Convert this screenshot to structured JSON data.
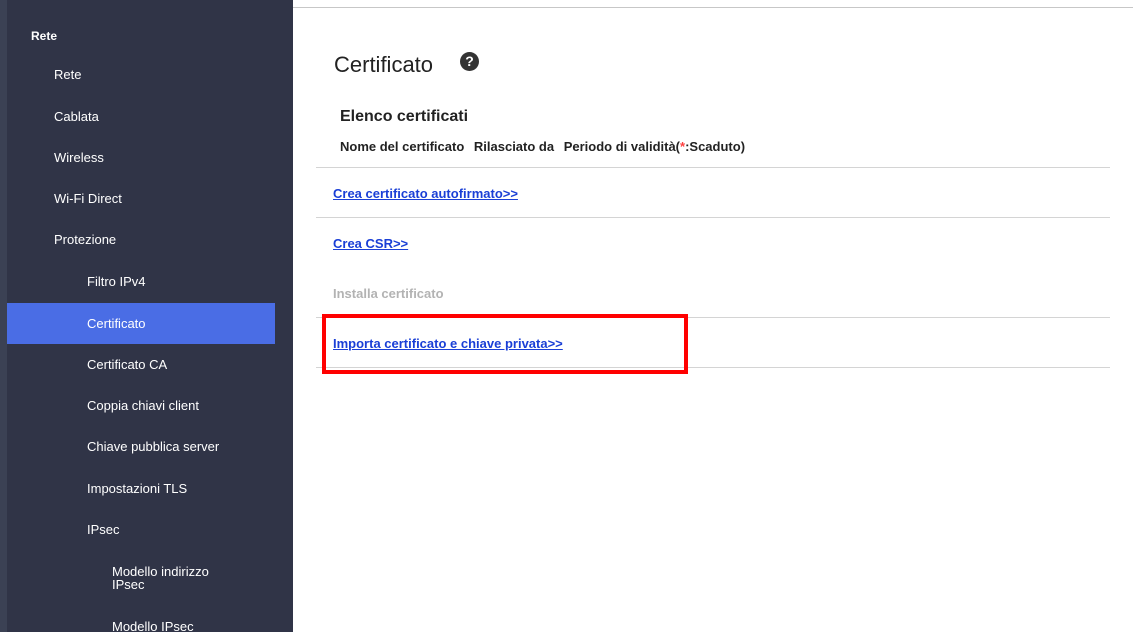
{
  "sidebar": {
    "items": [
      {
        "label": "Rete"
      },
      {
        "label": "Rete"
      },
      {
        "label": "Cablata"
      },
      {
        "label": "Wireless"
      },
      {
        "label": "Wi-Fi Direct"
      },
      {
        "label": "Protezione"
      },
      {
        "label": "Filtro IPv4"
      },
      {
        "label": "Certificato"
      },
      {
        "label": "Certificato CA"
      },
      {
        "label": "Coppia chiavi client"
      },
      {
        "label": "Chiave pubblica server"
      },
      {
        "label": "Impostazioni TLS"
      },
      {
        "label": "IPsec"
      },
      {
        "label": "Modello indirizzo",
        "label2": "IPsec"
      },
      {
        "label": "Modello IPsec"
      }
    ],
    "active_color": "#4a6de5",
    "background_color": "#303447"
  },
  "main": {
    "title": "Certificato",
    "help_icon": "?",
    "list_heading": "Elenco certificati",
    "columns": {
      "name": "Nome del certificato",
      "issuer": "Rilasciato da",
      "validity_prefix": "Periodo di validità(",
      "validity_asterisk": "*",
      "validity_suffix": ":Scaduto)"
    },
    "links": {
      "self_signed": "Crea certificato autofirmato>>",
      "csr": "Crea CSR>>",
      "install_disabled": "Installa certificato",
      "import": "Importa certificato e chiave privata>>"
    },
    "link_color": "#1a3fd6",
    "highlight_color": "#ff0000"
  }
}
